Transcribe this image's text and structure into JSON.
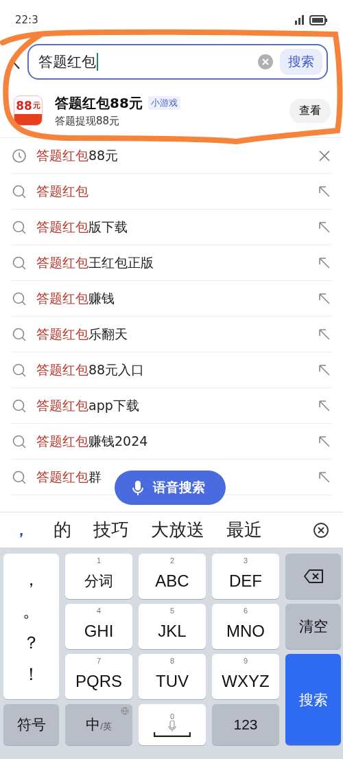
{
  "status_bar": {
    "time": "22:3"
  },
  "search": {
    "value": "答题红包",
    "button": "搜索"
  },
  "game": {
    "icon_label": "88",
    "icon_unit": "元",
    "title": "答题红包88元",
    "tag": "小游戏",
    "subtitle": "答题提现88元",
    "button": "查看"
  },
  "suggestions": [
    {
      "kind": "history",
      "match": "答题红包",
      "rest": "88元"
    },
    {
      "kind": "search",
      "match": "答题红包"
    },
    {
      "kind": "search",
      "match": "答题红包",
      "rest": "版下载"
    },
    {
      "kind": "search",
      "match": "答题红包",
      "rest": "王红包正版"
    },
    {
      "kind": "search",
      "match": "答题红包",
      "rest": "赚钱"
    },
    {
      "kind": "search",
      "match": "答题红包",
      "rest": "乐翻天"
    },
    {
      "kind": "search",
      "match": "答题红包",
      "rest": "88元入口"
    },
    {
      "kind": "search",
      "match": "答题红包",
      "rest": "app下载"
    },
    {
      "kind": "search",
      "match": "答题红包",
      "rest": "赚钱2024"
    },
    {
      "kind": "search",
      "match": "答题红包",
      "rest": "群"
    }
  ],
  "voice_button": "语音搜索",
  "candidates": {
    "punct": "，",
    "words": [
      "的",
      "技巧",
      "大放送",
      "最近"
    ]
  },
  "keys": [
    {
      "kind": "punct",
      "chars": [
        "，",
        "。",
        "？",
        "！"
      ]
    },
    {
      "kind": "t9",
      "num": "1",
      "label": "分词"
    },
    {
      "kind": "t9",
      "num": "2",
      "label": "ABC"
    },
    {
      "kind": "t9",
      "num": "3",
      "label": "DEF"
    },
    {
      "kind": "backspace"
    },
    {
      "kind": "t9",
      "num": "4",
      "label": "GHI"
    },
    {
      "kind": "t9",
      "num": "5",
      "label": "JKL"
    },
    {
      "kind": "t9",
      "num": "6",
      "label": "MNO"
    },
    {
      "kind": "action",
      "label": "清空"
    },
    {
      "kind": "t9",
      "num": "7",
      "label": "PQRS"
    },
    {
      "kind": "t9",
      "num": "8",
      "label": "TUV"
    },
    {
      "kind": "t9",
      "num": "9",
      "label": "WXYZ"
    },
    {
      "kind": "enter",
      "label": "搜索"
    },
    {
      "kind": "action",
      "label": "符号"
    },
    {
      "kind": "lang",
      "label": "中",
      "sub": "/英"
    },
    {
      "kind": "space",
      "num": "0"
    },
    {
      "kind": "action",
      "label": "123"
    }
  ]
}
